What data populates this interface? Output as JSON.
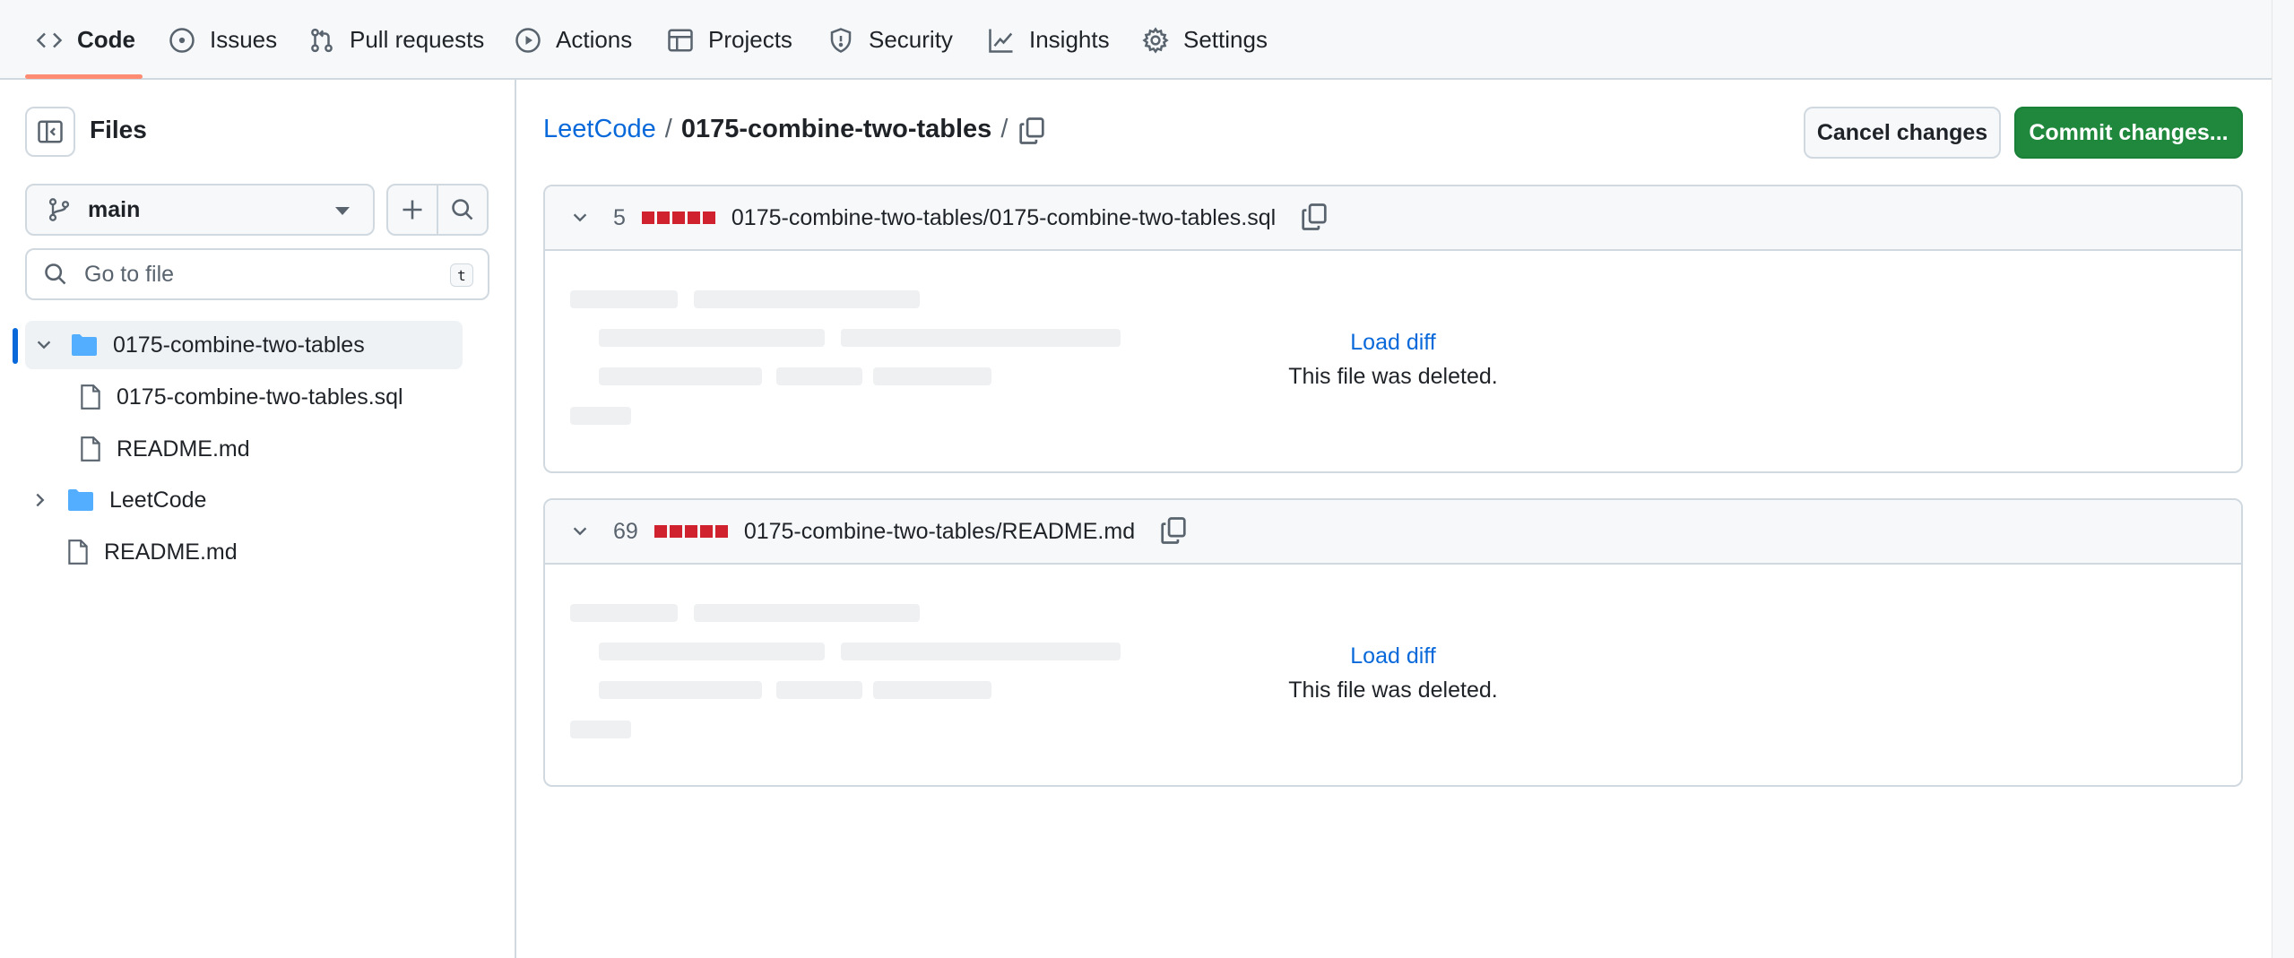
{
  "nav": {
    "items": [
      {
        "label": "Code",
        "icon": "code-icon"
      },
      {
        "label": "Issues",
        "icon": "issue-opened-icon"
      },
      {
        "label": "Pull requests",
        "icon": "git-pull-request-icon"
      },
      {
        "label": "Actions",
        "icon": "play-icon"
      },
      {
        "label": "Projects",
        "icon": "table-icon"
      },
      {
        "label": "Security",
        "icon": "shield-icon"
      },
      {
        "label": "Insights",
        "icon": "graph-icon"
      },
      {
        "label": "Settings",
        "icon": "gear-icon"
      }
    ],
    "active": "Code",
    "accent": "#fd8c73"
  },
  "sidebar": {
    "title": "Files",
    "branch": "main",
    "search_placeholder": "Go to file",
    "search_shortcut": "t",
    "tree": [
      {
        "label": "0175-combine-two-tables",
        "type": "folder",
        "expanded": true,
        "selected": true
      },
      {
        "label": "0175-combine-two-tables.sql",
        "type": "file"
      },
      {
        "label": "README.md",
        "type": "file"
      },
      {
        "label": "LeetCode",
        "type": "folder",
        "expanded": false
      },
      {
        "label": "README.md",
        "type": "file"
      }
    ]
  },
  "breadcrumb": {
    "root": "LeetCode",
    "sep": "/",
    "current": "0175-combine-two-tables"
  },
  "actions": {
    "cancel_label": "Cancel changes",
    "commit_label": "Commit changes..."
  },
  "diffs": [
    {
      "count": "5",
      "path": "0175-combine-two-tables/0175-combine-two-tables.sql",
      "load_label": "Load diff",
      "message": "This file was deleted."
    },
    {
      "count": "69",
      "path": "0175-combine-two-tables/README.md",
      "load_label": "Load diff",
      "message": "This file was deleted."
    }
  ],
  "colors": {
    "link": "#0969da",
    "commit_green": "#1f883d",
    "deletion_red": "#cf222e"
  }
}
